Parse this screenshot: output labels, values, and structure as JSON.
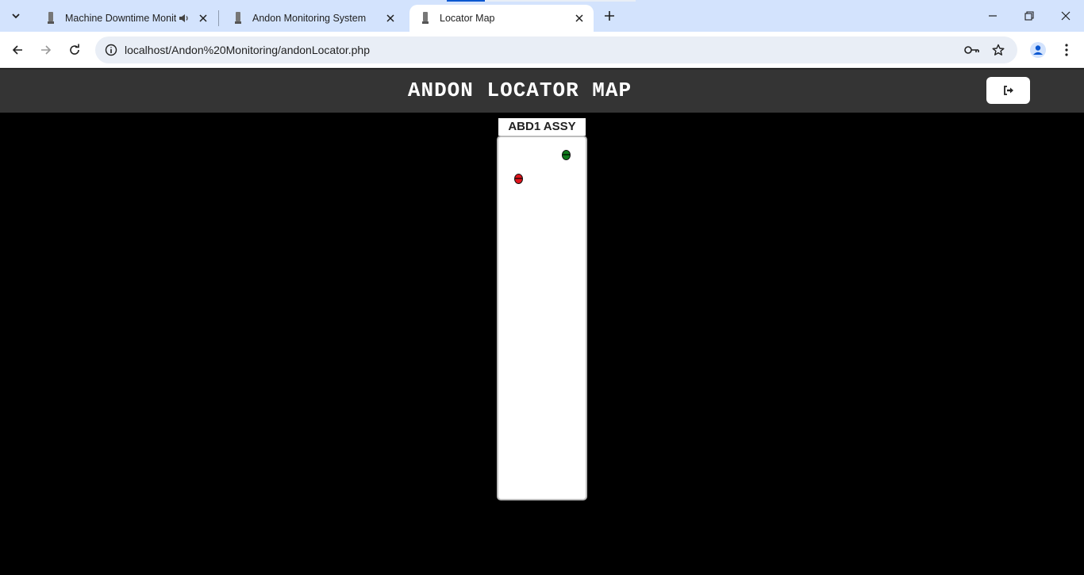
{
  "browser": {
    "tabs": [
      {
        "title": "Machine Downtime Monito",
        "active": false,
        "audio": true
      },
      {
        "title": "Andon Monitoring System",
        "active": false,
        "audio": false
      },
      {
        "title": "Locator Map",
        "active": true,
        "audio": false
      }
    ],
    "url": "localhost/Andon%20Monitoring/andonLocator.php"
  },
  "page": {
    "title": "ANDON LOCATOR MAP",
    "logout_icon": "sign-out-icon",
    "line": {
      "label": "ABD1 ASSY",
      "lamps": [
        {
          "status": "green",
          "color": "#0f7a1c"
        },
        {
          "status": "red",
          "color": "#e0141b"
        }
      ]
    }
  },
  "colors": {
    "header_bg": "#343434",
    "page_bg": "#000000",
    "tabstrip_bg": "#d3e3fd"
  }
}
